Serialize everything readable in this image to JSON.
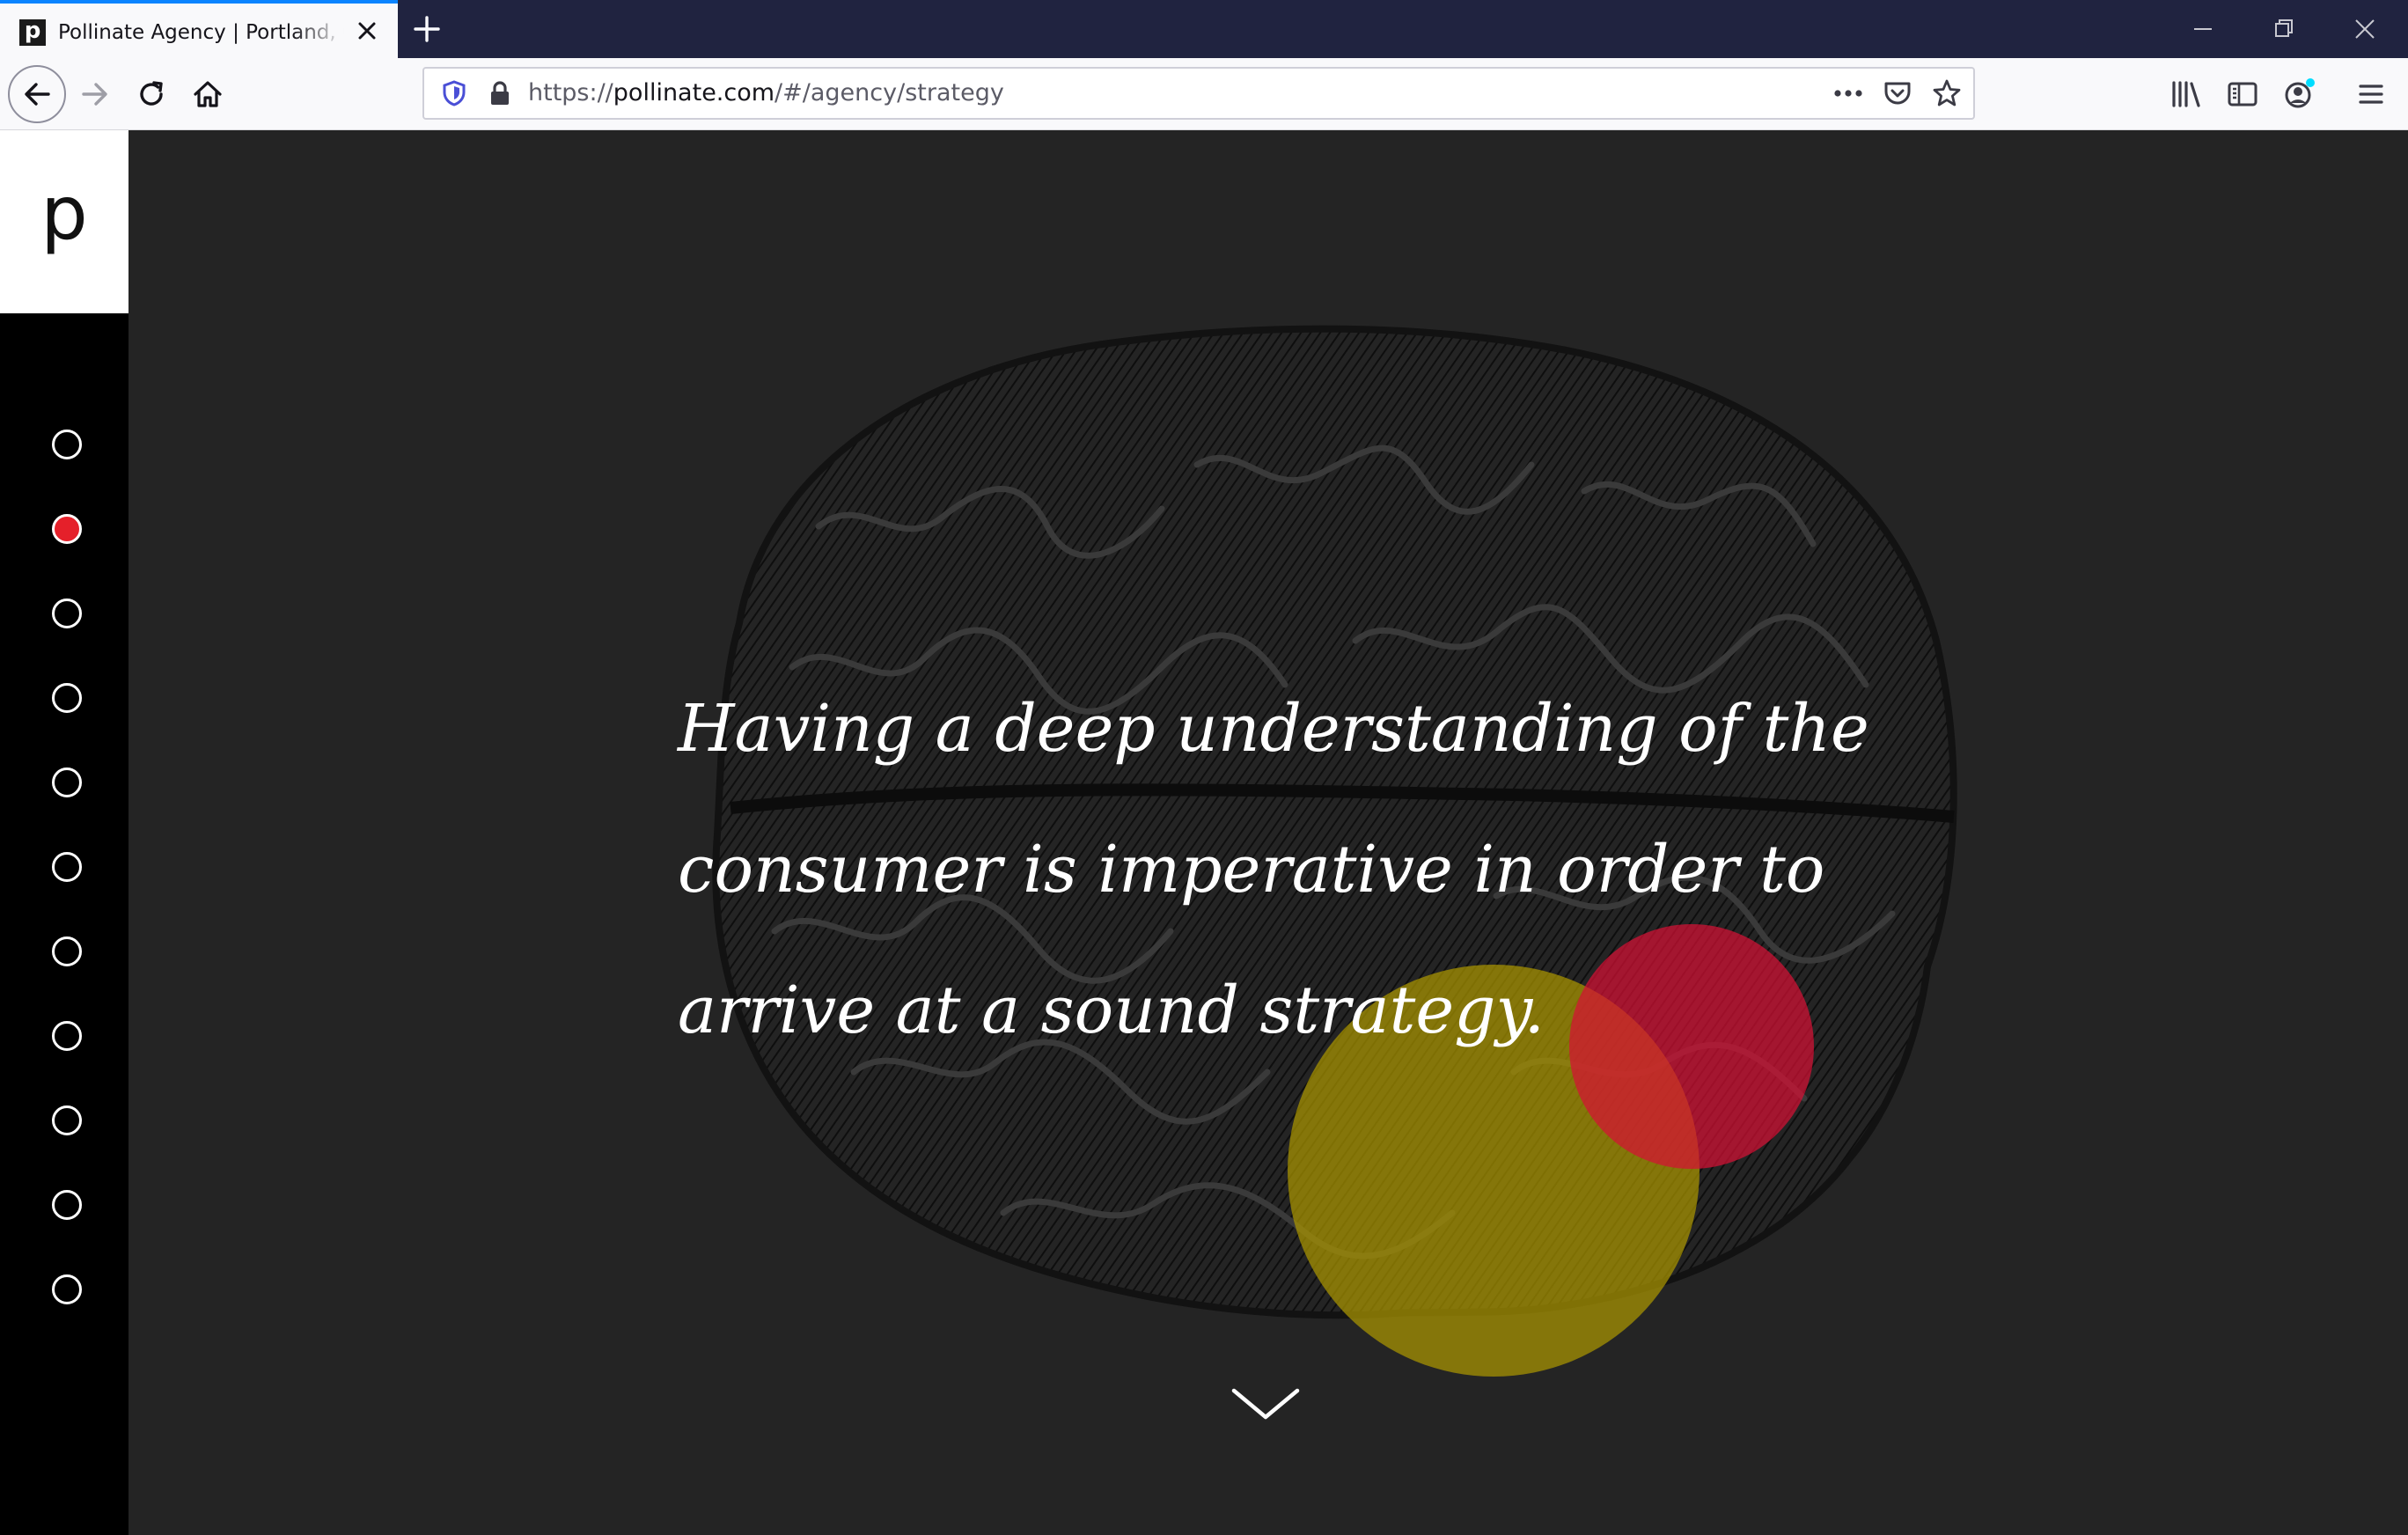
{
  "browser": {
    "tab": {
      "favicon_letter": "p",
      "title": "Pollinate Agency | Portland, Oregon"
    },
    "url": {
      "prefix": "https://",
      "domain": "pollinate.com",
      "path": "/#/agency/strategy"
    },
    "icons": {
      "back": "back-arrow-icon",
      "forward": "forward-arrow-icon",
      "reload": "reload-icon",
      "home": "home-icon",
      "tracking": "shield-icon",
      "lock": "lock-icon",
      "page_actions": "more-icon",
      "pocket": "pocket-icon",
      "bookmark": "star-icon",
      "library": "library-icon",
      "sidebar": "sidebar-icon",
      "account": "account-icon",
      "menu": "hamburger-menu-icon"
    },
    "accent_color": "#0a84ff"
  },
  "site": {
    "logo": "p",
    "nav": {
      "count": 11,
      "active_index": 1,
      "active_color": "#e5202a"
    },
    "quote": "Having a deep understanding of the consumer is imperative in order to arrive at a sound strategy.",
    "background_color": "#242424",
    "circle_colors": {
      "yellow": "#aa9600",
      "red": "#d61034"
    },
    "scroll_icon": "chevron-down-icon"
  }
}
